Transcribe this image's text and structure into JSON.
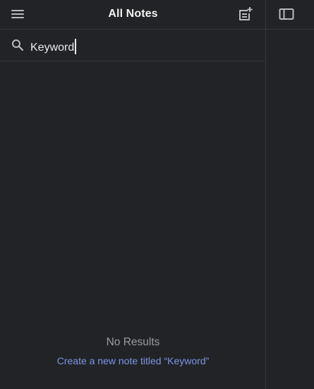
{
  "header": {
    "title": "All Notes"
  },
  "icons": {
    "menu": "hamburger-menu-icon",
    "new_note": "new-note-icon",
    "sidebar": "sidebar-toggle-icon",
    "search": "search-icon"
  },
  "search": {
    "value": "Keyword"
  },
  "results": {
    "empty_label": "No Results",
    "create_link": "Create a new note titled “Keyword”"
  },
  "colors": {
    "background": "#222326",
    "divider": "#34363b",
    "title_text": "#f2f2f3",
    "muted_text": "#9b9ca0",
    "link": "#7d95e6",
    "icon": "#b9babd"
  }
}
